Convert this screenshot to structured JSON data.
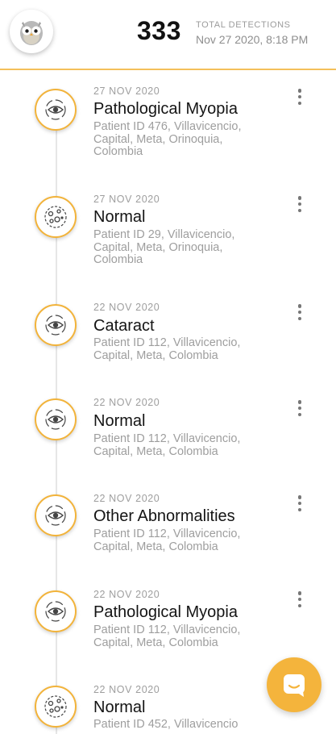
{
  "header": {
    "logo_icon": "owl-logo-icon",
    "total_count": "333",
    "total_label": "TOTAL DETECTIONS",
    "timestamp": "Nov 27 2020, 8:18 PM"
  },
  "detections": [
    {
      "date": "27 NOV 2020",
      "title": "Pathological Myopia",
      "desc": "Patient ID 476, Villavicencio, Capital, Meta, Orinoquia, Colombia",
      "icon": "eye-scan-icon"
    },
    {
      "date": "27 NOV 2020",
      "title": "Normal",
      "desc": "Patient ID 29, Villavicencio, Capital, Meta, Orinoquia, Colombia",
      "icon": "fundus-icon"
    },
    {
      "date": "22 NOV 2020",
      "title": "Cataract",
      "desc": "Patient ID 112, Villavicencio, Capital, Meta, Colombia",
      "icon": "eye-scan-icon"
    },
    {
      "date": "22 NOV 2020",
      "title": "Normal",
      "desc": "Patient ID 112, Villavicencio, Capital, Meta, Colombia",
      "icon": "eye-scan-icon"
    },
    {
      "date": "22 NOV 2020",
      "title": "Other Abnormalities",
      "desc": "Patient ID 112, Villavicencio, Capital, Meta, Colombia",
      "icon": "eye-scan-icon"
    },
    {
      "date": "22 NOV 2020",
      "title": "Pathological Myopia",
      "desc": "Patient ID 112, Villavicencio, Capital, Meta, Colombia",
      "icon": "eye-scan-icon"
    },
    {
      "date": "22 NOV 2020",
      "title": "Normal",
      "desc": "Patient ID 452, Villavicencio",
      "icon": "fundus-icon"
    }
  ],
  "fab": {
    "icon": "chat-icon"
  },
  "colors": {
    "accent": "#f4b43c",
    "divider": "#f4c05a"
  }
}
